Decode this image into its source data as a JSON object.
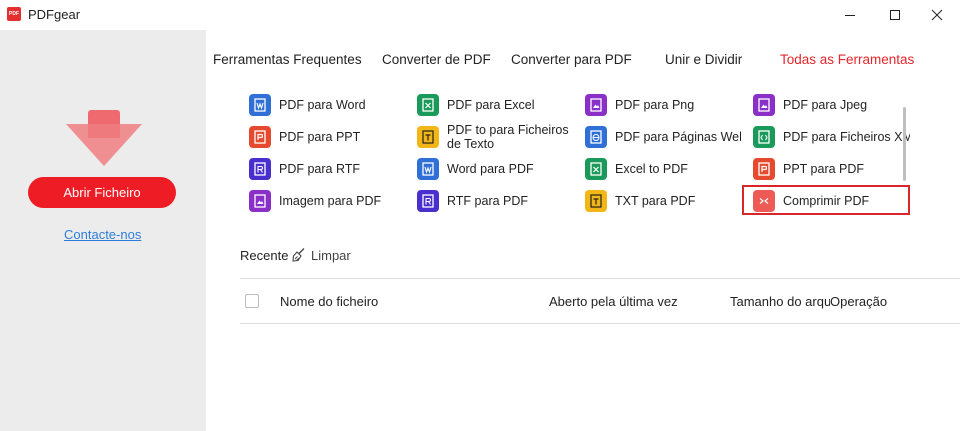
{
  "app": {
    "logo_text": "PDF",
    "title": "PDFgear"
  },
  "sidebar": {
    "open_button": "Abrir Ficheiro",
    "contact_link": "Contacte-nos",
    "accent": "#ee1c25"
  },
  "tabs": [
    {
      "label": "Ferramentas Frequentes",
      "active": false
    },
    {
      "label": "Converter de PDF",
      "active": false
    },
    {
      "label": "Converter para PDF",
      "active": false
    },
    {
      "label": "Unir e Dividir",
      "active": false
    },
    {
      "label": "Todas as Ferramentas",
      "active": true
    }
  ],
  "tools": [
    {
      "label": "PDF para Word",
      "icon": "pdf-word-icon",
      "color": "blue"
    },
    {
      "label": "PDF para Excel",
      "icon": "pdf-excel-icon",
      "color": "green"
    },
    {
      "label": "PDF para Png",
      "icon": "pdf-png-icon",
      "color": "purple"
    },
    {
      "label": "PDF para Jpeg",
      "icon": "pdf-jpeg-icon",
      "color": "purple"
    },
    {
      "label": "PDF para PPT",
      "icon": "pdf-ppt-icon",
      "color": "red"
    },
    {
      "label": "PDF to para Ficheiros de Texto",
      "icon": "pdf-text-icon",
      "color": "yellow"
    },
    {
      "label": "PDF para Páginas Web",
      "icon": "pdf-html-icon",
      "color": "blue"
    },
    {
      "label": "PDF para Ficheiros XML",
      "icon": "pdf-xml-icon",
      "color": "green"
    },
    {
      "label": "PDF para RTF",
      "icon": "pdf-rtf-icon",
      "color": "navy"
    },
    {
      "label": "Word para PDF",
      "icon": "word-pdf-icon",
      "color": "blue"
    },
    {
      "label": "Excel to PDF",
      "icon": "excel-pdf-icon",
      "color": "green"
    },
    {
      "label": "PPT para PDF",
      "icon": "ppt-pdf-icon",
      "color": "red"
    },
    {
      "label": "Imagem para PDF",
      "icon": "image-pdf-icon",
      "color": "purple"
    },
    {
      "label": "RTF para PDF",
      "icon": "rtf-pdf-icon",
      "color": "navy"
    },
    {
      "label": "TXT para PDF",
      "icon": "txt-pdf-icon",
      "color": "yellow"
    },
    {
      "label": "Comprimir PDF",
      "icon": "compress-pdf-icon",
      "color": "pink"
    }
  ],
  "recent": {
    "label": "Recente",
    "clear": "Limpar",
    "columns": [
      "Nome do ficheiro",
      "Aberto pela última vez",
      "Tamanho do arquivo",
      "Operação"
    ]
  }
}
